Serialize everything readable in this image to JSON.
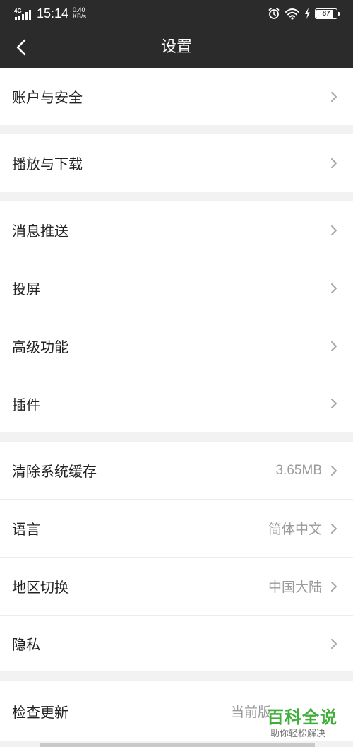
{
  "status_bar": {
    "network": "4G",
    "time": "15:14",
    "net_speed_value": "0.40",
    "net_speed_unit": "KB/s",
    "battery": "87",
    "icons": [
      "signal-icon",
      "alarm-icon",
      "wifi-icon",
      "charging-icon",
      "battery-icon"
    ]
  },
  "header": {
    "back_icon": "chevron-left-icon",
    "title": "设置"
  },
  "settings": {
    "account_security": {
      "label": "账户与安全"
    },
    "playback_download": {
      "label": "播放与下载"
    },
    "message_push": {
      "label": "消息推送"
    },
    "screen_cast": {
      "label": "投屏"
    },
    "advanced_features": {
      "label": "高级功能"
    },
    "plugins": {
      "label": "插件"
    },
    "clear_cache": {
      "label": "清除系统缓存",
      "value": "3.65MB"
    },
    "language": {
      "label": "语言",
      "value": "简体中文"
    },
    "region": {
      "label": "地区切换",
      "value": "中国大陆"
    },
    "privacy": {
      "label": "隐私"
    },
    "check_update": {
      "label": "检查更新",
      "value": "当前版"
    }
  },
  "watermark": {
    "main": "百科全说",
    "sub": "助你轻松解决"
  },
  "colors": {
    "header_bg": "#2b2b2b",
    "page_bg": "#f2f2f2",
    "row_bg": "#ffffff",
    "label_text": "#222222",
    "value_text": "#9b9b9b",
    "watermark_green": "#3fae3a"
  }
}
